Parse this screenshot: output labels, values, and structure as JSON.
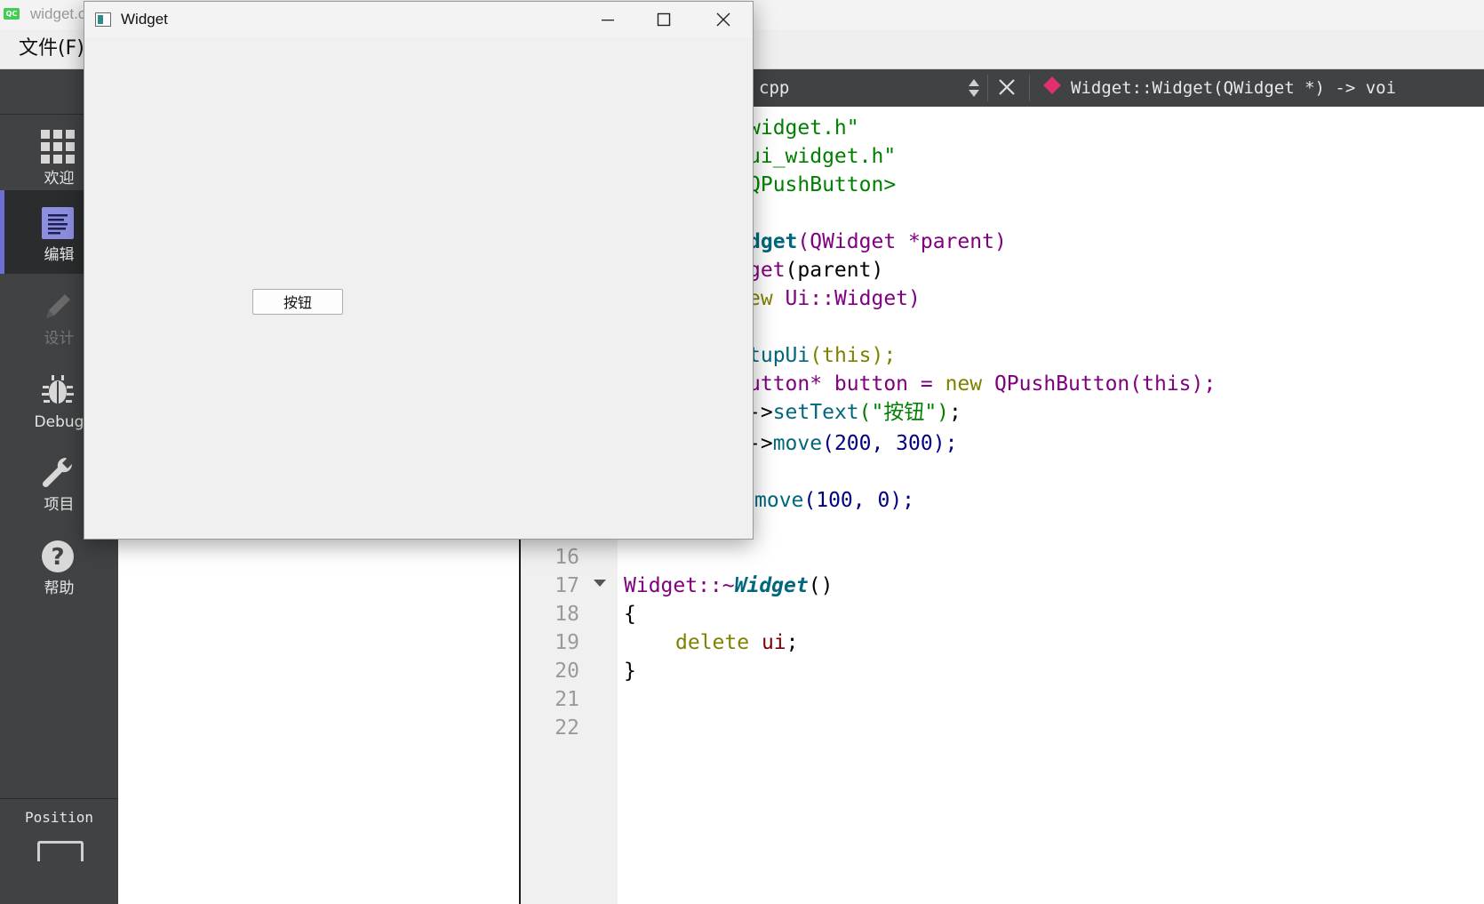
{
  "main_window": {
    "title": "widget.c",
    "menu_file": "文件(F)"
  },
  "mode_bar": {
    "modes": [
      {
        "label": "欢迎",
        "icon": "welcome-grid-icon"
      },
      {
        "label": "编辑",
        "icon": "edit-document-icon",
        "active": true
      },
      {
        "label": "设计",
        "icon": "design-pencil-icon",
        "disabled": true
      },
      {
        "label": "Debug",
        "icon": "debug-bug-icon"
      },
      {
        "label": "项目",
        "icon": "project-wrench-icon"
      },
      {
        "label": "帮助",
        "icon": "help-question-icon"
      }
    ],
    "position_label": "Position"
  },
  "editor_toolbar": {
    "file_name": "cpp",
    "symbol": "Widget::Widget(QWidget *) -> voi"
  },
  "code_lines": {
    "l1_str": "widget.h\"",
    "l2_str": "ui_widget.h\"",
    "l3_str": "QPushButton>",
    "l5_fn": "dget",
    "l5_rest": "(QWidget *parent)",
    "l6_fn": "get",
    "l6_rest": "(parent)",
    "l7_kw": "ew",
    "l7_rest": " Ui::Widget)",
    "l9_fn": "tupUi",
    "l9_rest": "(this);",
    "l10_a": "utton* button = ",
    "l10_kw": "new",
    "l10_b": " QPushButton(this);",
    "l11_a": "->",
    "l11_fn": "setText",
    "l11_str": "(\"按钮\")",
    "l11_end": ";",
    "l12_a": "->",
    "l12_fn": "move",
    "l12_args": "(200, 300);",
    "l14_fn": "move",
    "l14_args": "(100, 0);",
    "l15_brace": "}",
    "l17_ty": "Widget::~",
    "l17_fn": "Widget",
    "l17_rest": "()",
    "l18": "{",
    "l19_kw": "delete",
    "l19_var": " ui",
    "l19_end": ";",
    "l20": "}"
  },
  "line_numbers": [
    "16",
    "17",
    "18",
    "19",
    "20",
    "21",
    "22"
  ],
  "widget_window": {
    "title": "Widget",
    "button_label": "按钮"
  },
  "colors": {
    "mode_bar_bg": "#404244",
    "active_accent": "#6d6fd1",
    "string_green": "#008000",
    "keyword_olive": "#808000",
    "function_teal": "#00677c",
    "type_purple": "#800080"
  }
}
